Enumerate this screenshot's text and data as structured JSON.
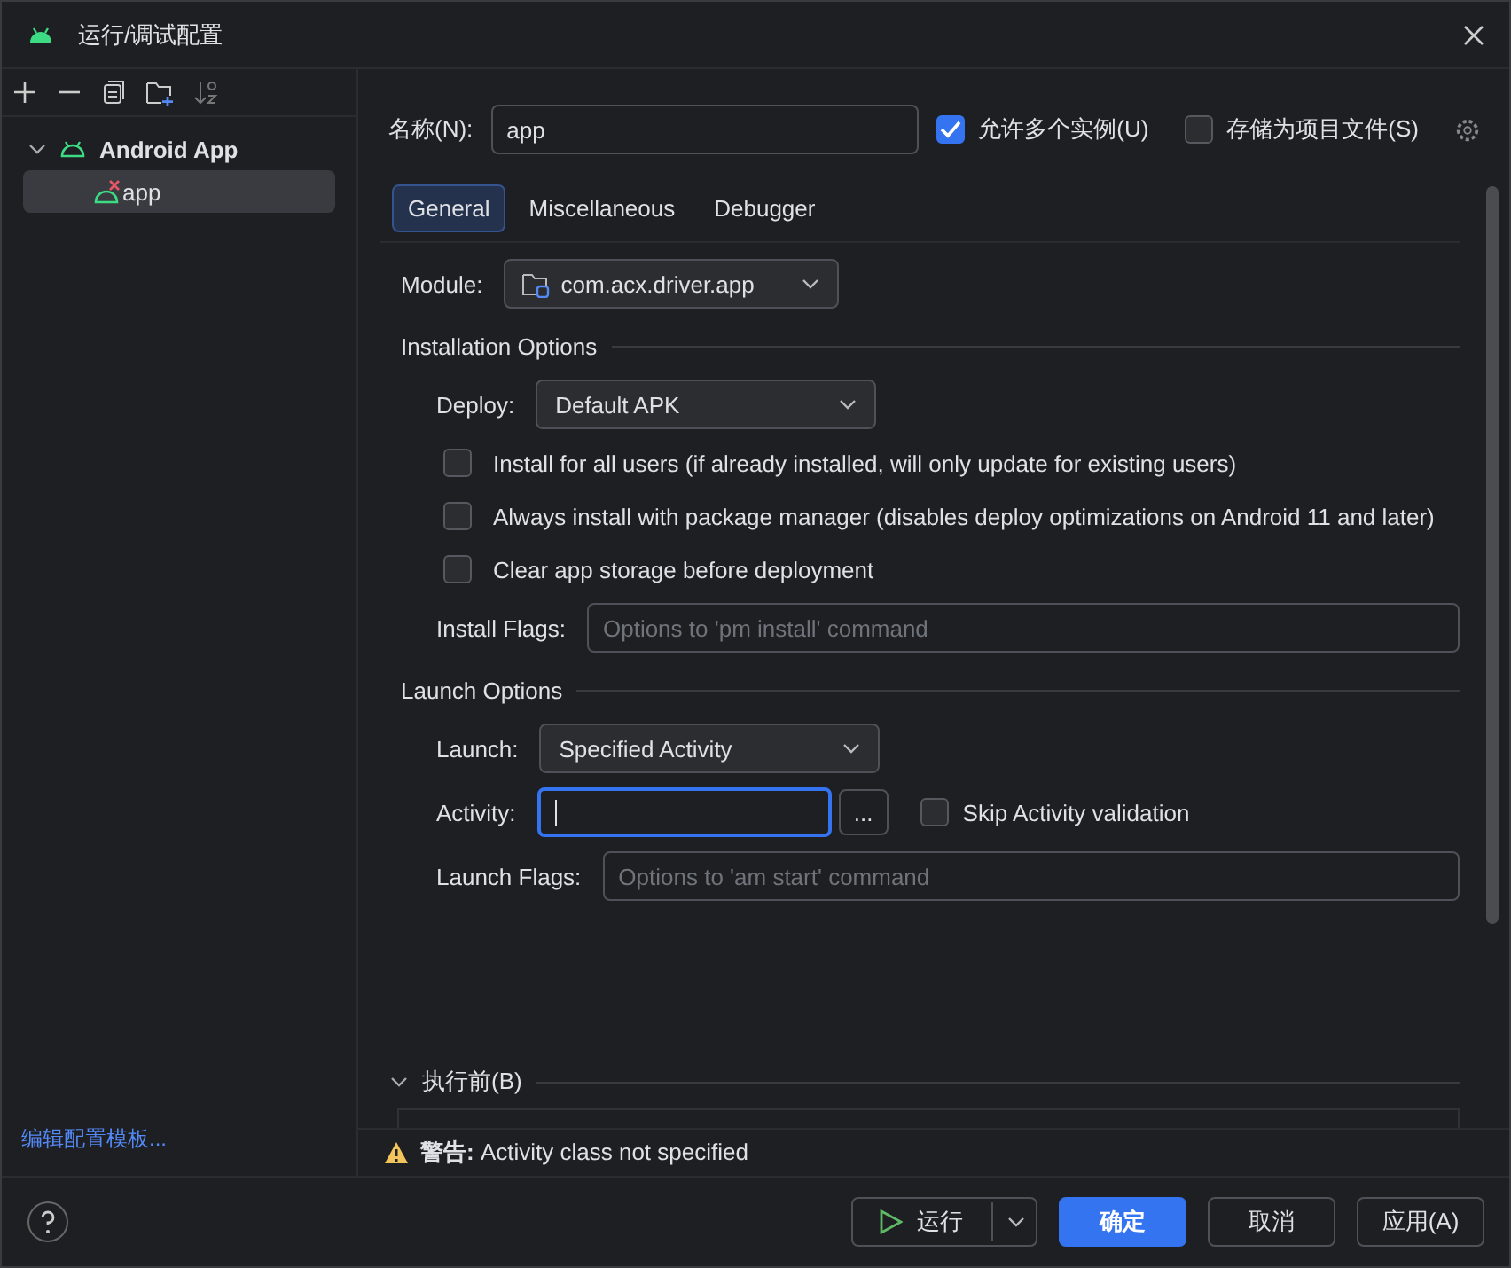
{
  "window": {
    "title": "运行/调试配置"
  },
  "sidebar": {
    "tree": [
      {
        "label": "Android App",
        "expanded": true,
        "children": [
          {
            "label": "app",
            "selected": true
          }
        ]
      }
    ],
    "footer_link": "编辑配置模板..."
  },
  "name_field": {
    "label": "名称(N):",
    "value": "app"
  },
  "options": [
    {
      "label": "允许多个实例(U)",
      "checked": true
    },
    {
      "label": "存储为项目文件(S)",
      "checked": false
    }
  ],
  "tabs": [
    {
      "label": "General",
      "selected": true
    },
    {
      "label": "Miscellaneous",
      "selected": false
    },
    {
      "label": "Debugger",
      "selected": false
    }
  ],
  "module": {
    "label": "Module:",
    "value": "com.acx.driver.app"
  },
  "sections": [
    {
      "title": "Installation Options",
      "rows": [
        {
          "kind": "dropdown",
          "label": "Deploy:",
          "value": "Default APK"
        },
        {
          "kind": "checkbox",
          "label": "Install for all users (if already installed, will only update for existing users)",
          "checked": false
        },
        {
          "kind": "checkbox",
          "label": "Always install with package manager (disables deploy optimizations on Android 11 and later)",
          "checked": false
        },
        {
          "kind": "checkbox",
          "label": "Clear app storage before deployment",
          "checked": false
        },
        {
          "kind": "field",
          "label": "Install Flags:",
          "placeholder": "Options to 'pm install' command"
        }
      ]
    },
    {
      "title": "Launch Options",
      "rows": [
        {
          "kind": "dropdown",
          "label": "Launch:",
          "value": "Specified Activity"
        },
        {
          "kind": "activity",
          "label": "Activity:",
          "focused": true,
          "browse": "...",
          "option": {
            "label": "Skip Activity validation",
            "checked": false
          }
        },
        {
          "kind": "field",
          "label": "Launch Flags:",
          "placeholder": "Options to 'am start' command"
        }
      ]
    }
  ],
  "before_launch": {
    "title": "执行前(B)",
    "expanded": true
  },
  "warning": "**警告:** Activity class not specified",
  "footer": {
    "run_button": "运行",
    "buttons": [
      {
        "label": "确定",
        "primary": true
      },
      {
        "label": "取消",
        "primary": false
      },
      {
        "label": "应用(A)",
        "primary": false
      }
    ]
  }
}
